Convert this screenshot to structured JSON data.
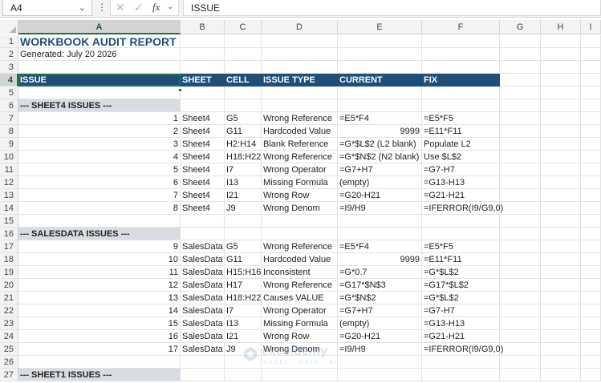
{
  "formula_bar": {
    "name_box": "A4",
    "formula": "ISSUE"
  },
  "columns": [
    "A",
    "B",
    "C",
    "D",
    "E",
    "F",
    "G",
    "H",
    "I"
  ],
  "rows": [
    {
      "n": "1",
      "cells": {
        "A": "WORKBOOK AUDIT REPORT"
      }
    },
    {
      "n": "2",
      "cells": {
        "A": "Generated: July 20 2026"
      }
    },
    {
      "n": "3",
      "cells": {}
    },
    {
      "n": "4",
      "cells": {
        "A": "ISSUE",
        "B": "SHEET",
        "C": "CELL",
        "D": "ISSUE TYPE",
        "E": "CURRENT",
        "F": "FIX"
      }
    },
    {
      "n": "5",
      "cells": {}
    },
    {
      "n": "6",
      "cells": {
        "A": "--- SHEET4 ISSUES ---"
      }
    },
    {
      "n": "7",
      "cells": {
        "A": "1",
        "B": "Sheet4",
        "C": "G5",
        "D": "Wrong Reference",
        "E": "=E5*F4",
        "F": "=E5*F5"
      }
    },
    {
      "n": "8",
      "cells": {
        "A": "2",
        "B": "Sheet4",
        "C": "G11",
        "D": "Hardcoded Value",
        "E": "9999",
        "F": "=E11*F11"
      }
    },
    {
      "n": "9",
      "cells": {
        "A": "3",
        "B": "Sheet4",
        "C": "H2:H14",
        "D": "Blank Reference",
        "E": "=G*$L$2 (L2 blank)",
        "F": "Populate L2"
      }
    },
    {
      "n": "10",
      "cells": {
        "A": "4",
        "B": "Sheet4",
        "C": "H18:H22",
        "D": "Wrong Reference",
        "E": "=G*$N$2 (N2 blank)",
        "F": "Use $L$2"
      }
    },
    {
      "n": "11",
      "cells": {
        "A": "5",
        "B": "Sheet4",
        "C": "I7",
        "D": "Wrong Operator",
        "E": "=G7+H7",
        "F": "=G7-H7"
      }
    },
    {
      "n": "12",
      "cells": {
        "A": "6",
        "B": "Sheet4",
        "C": "I13",
        "D": "Missing Formula",
        "E": "(empty)",
        "F": "=G13-H13"
      }
    },
    {
      "n": "13",
      "cells": {
        "A": "7",
        "B": "Sheet4",
        "C": "I21",
        "D": "Wrong Row",
        "E": "=G20-H21",
        "F": "=G21-H21"
      }
    },
    {
      "n": "14",
      "cells": {
        "A": "8",
        "B": "Sheet4",
        "C": "J9",
        "D": "Wrong Denom",
        "E": "=I9/H9",
        "F": "=IFERROR(I9/G9,0)"
      }
    },
    {
      "n": "15",
      "cells": {}
    },
    {
      "n": "16",
      "cells": {
        "A": "--- SALESDATA ISSUES ---"
      }
    },
    {
      "n": "17",
      "cells": {
        "A": "9",
        "B": "SalesData",
        "C": "G5",
        "D": "Wrong Reference",
        "E": "=E5*F4",
        "F": "=E5*F5"
      }
    },
    {
      "n": "18",
      "cells": {
        "A": "10",
        "B": "SalesData",
        "C": "G11",
        "D": "Hardcoded Value",
        "E": "9999",
        "F": "=E11*F11"
      }
    },
    {
      "n": "19",
      "cells": {
        "A": "11",
        "B": "SalesData",
        "C": "H15:H16",
        "D": "Inconsistent",
        "E": "=G*0.7",
        "F": "=G*$L$2"
      }
    },
    {
      "n": "20",
      "cells": {
        "A": "12",
        "B": "SalesData",
        "C": "H17",
        "D": "Wrong Reference",
        "E": "=G17*$N$3",
        "F": "=G17*$L$2"
      }
    },
    {
      "n": "21",
      "cells": {
        "A": "13",
        "B": "SalesData",
        "C": "H18:H22",
        "D": "Causes VALUE",
        "E": "=G*$N$2",
        "F": "=G*$L$2"
      }
    },
    {
      "n": "22",
      "cells": {
        "A": "14",
        "B": "SalesData",
        "C": "I7",
        "D": "Wrong Operator",
        "E": "=G7+H7",
        "F": "=G7-H7"
      }
    },
    {
      "n": "23",
      "cells": {
        "A": "15",
        "B": "SalesData",
        "C": "I13",
        "D": "Missing Formula",
        "E": "(empty)",
        "F": "=G13-H13"
      }
    },
    {
      "n": "24",
      "cells": {
        "A": "16",
        "B": "SalesData",
        "C": "I21",
        "D": "Wrong Row",
        "E": "=G20-H21",
        "F": "=G21-H21"
      }
    },
    {
      "n": "25",
      "cells": {
        "A": "17",
        "B": "SalesData",
        "C": "J9",
        "D": "Wrong Denom",
        "E": "=I9/H9",
        "F": "=IFERROR(I9/G9,0)"
      }
    },
    {
      "n": "26",
      "cells": {}
    },
    {
      "n": "27",
      "cells": {
        "A": "--- SHEET1 ISSUES ---"
      }
    }
  ],
  "watermark": {
    "name": "exceldemy",
    "tagline": "EXCEL · DATA · BI"
  },
  "colors": {
    "header_fill": "#1f4e79",
    "title_text": "#1f4e79",
    "section_fill": "#d9dce3",
    "selection": "#217346"
  }
}
